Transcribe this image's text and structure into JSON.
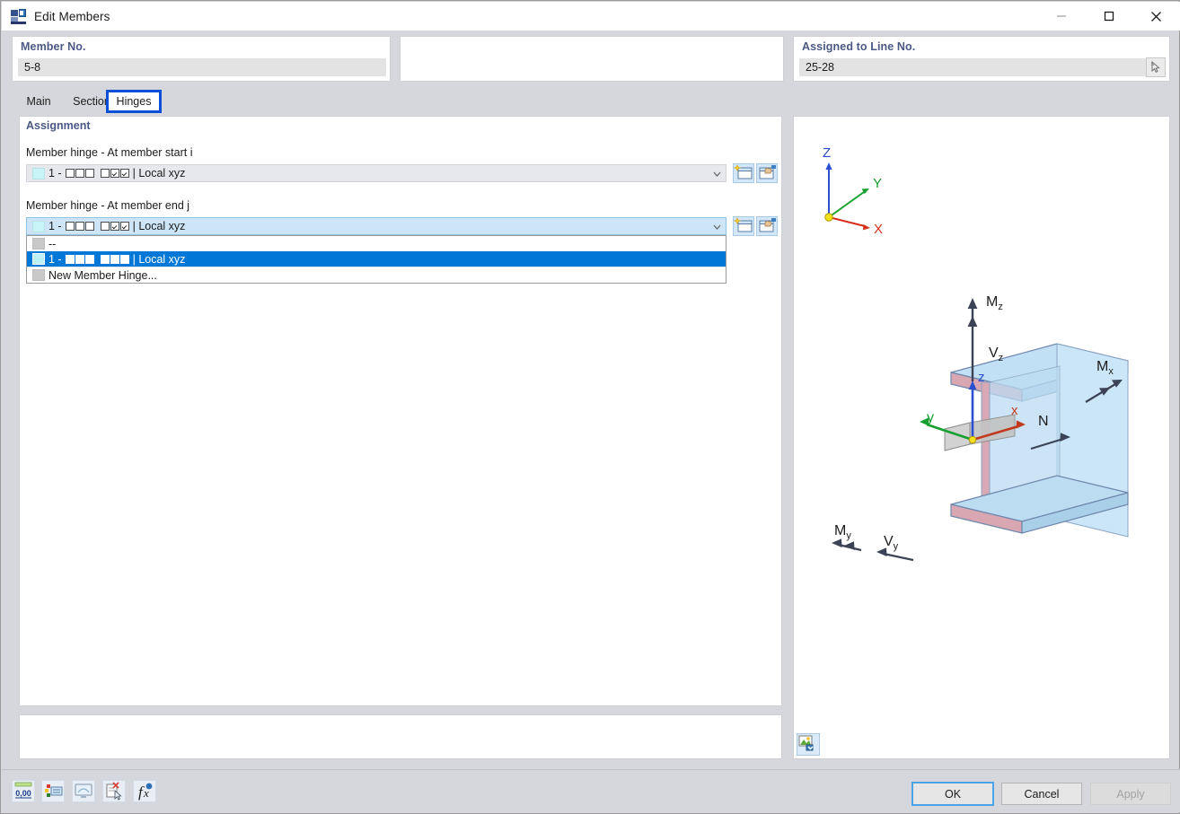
{
  "window": {
    "title": "Edit Members",
    "icon": "member-dialog-icon",
    "controls": {
      "minimize": "minimize-icon",
      "maximize": "maximize-icon",
      "close": "close-icon"
    }
  },
  "header": {
    "member_no": {
      "label": "Member No.",
      "value": "5-8"
    },
    "middle_panel": {
      "value": ""
    },
    "assigned_line": {
      "label": "Assigned to Line No.",
      "value": "25-28",
      "pick_icon": "pick-cursor-icon"
    }
  },
  "tabs": [
    {
      "label": "Main",
      "selected": false
    },
    {
      "label": "Section",
      "selected": false
    },
    {
      "label": "Hinges",
      "selected": true
    }
  ],
  "assignment": {
    "title": "Assignment",
    "start": {
      "label": "Member hinge - At member start i",
      "value_prefix": "1 -",
      "value_suffix": "| Local xyz",
      "checks": [
        false,
        false,
        false,
        false,
        true,
        true
      ],
      "new_icon": "new-member-hinge-icon",
      "edit_icon": "edit-member-hinge-icon"
    },
    "end": {
      "label": "Member hinge - At member end j",
      "value_prefix": "1 -",
      "value_suffix": "| Local xyz",
      "checks": [
        false,
        false,
        false,
        false,
        true,
        true
      ],
      "new_icon": "new-member-hinge-icon",
      "edit_icon": "edit-member-hinge-icon"
    },
    "dropdown_options": [
      {
        "text": "--",
        "prefix": "",
        "suffix": "",
        "swatch": "gray",
        "checks": [],
        "highlighted": false
      },
      {
        "text": "",
        "prefix": "1 -",
        "suffix": "| Local xyz",
        "swatch": "cyan",
        "checks": [
          false,
          false,
          false,
          false,
          true,
          true
        ],
        "highlighted": true
      },
      {
        "text": "New Member Hinge...",
        "prefix": "",
        "suffix": "",
        "swatch": "gray",
        "checks": [],
        "highlighted": false
      }
    ]
  },
  "preview": {
    "global_axes": {
      "z": "Z",
      "y": "Y",
      "x": "X"
    },
    "local_axes": {
      "z": "z",
      "y": "y",
      "x": "x"
    },
    "force_labels": {
      "mz": "Mz",
      "vz": "Vz",
      "mx": "Mx",
      "n": "N",
      "my": "My",
      "vy": "Vy"
    },
    "snapshot_icon": "preview-snapshot-icon"
  },
  "toolbar": [
    {
      "name": "decimal-places-icon",
      "label": "0,00"
    },
    {
      "name": "rename-icon",
      "label": ""
    },
    {
      "name": "display-properties-icon",
      "label": ""
    },
    {
      "name": "delete-icon",
      "label": ""
    },
    {
      "name": "formula-icon",
      "label": "fx"
    }
  ],
  "footer": {
    "ok": "OK",
    "cancel": "Cancel",
    "apply": "Apply"
  },
  "colors": {
    "accent": "#0078d7",
    "tab_highlight": "#0b4fd6",
    "label_blue": "#4a5a85",
    "combo_selected": "#cde5f7"
  }
}
